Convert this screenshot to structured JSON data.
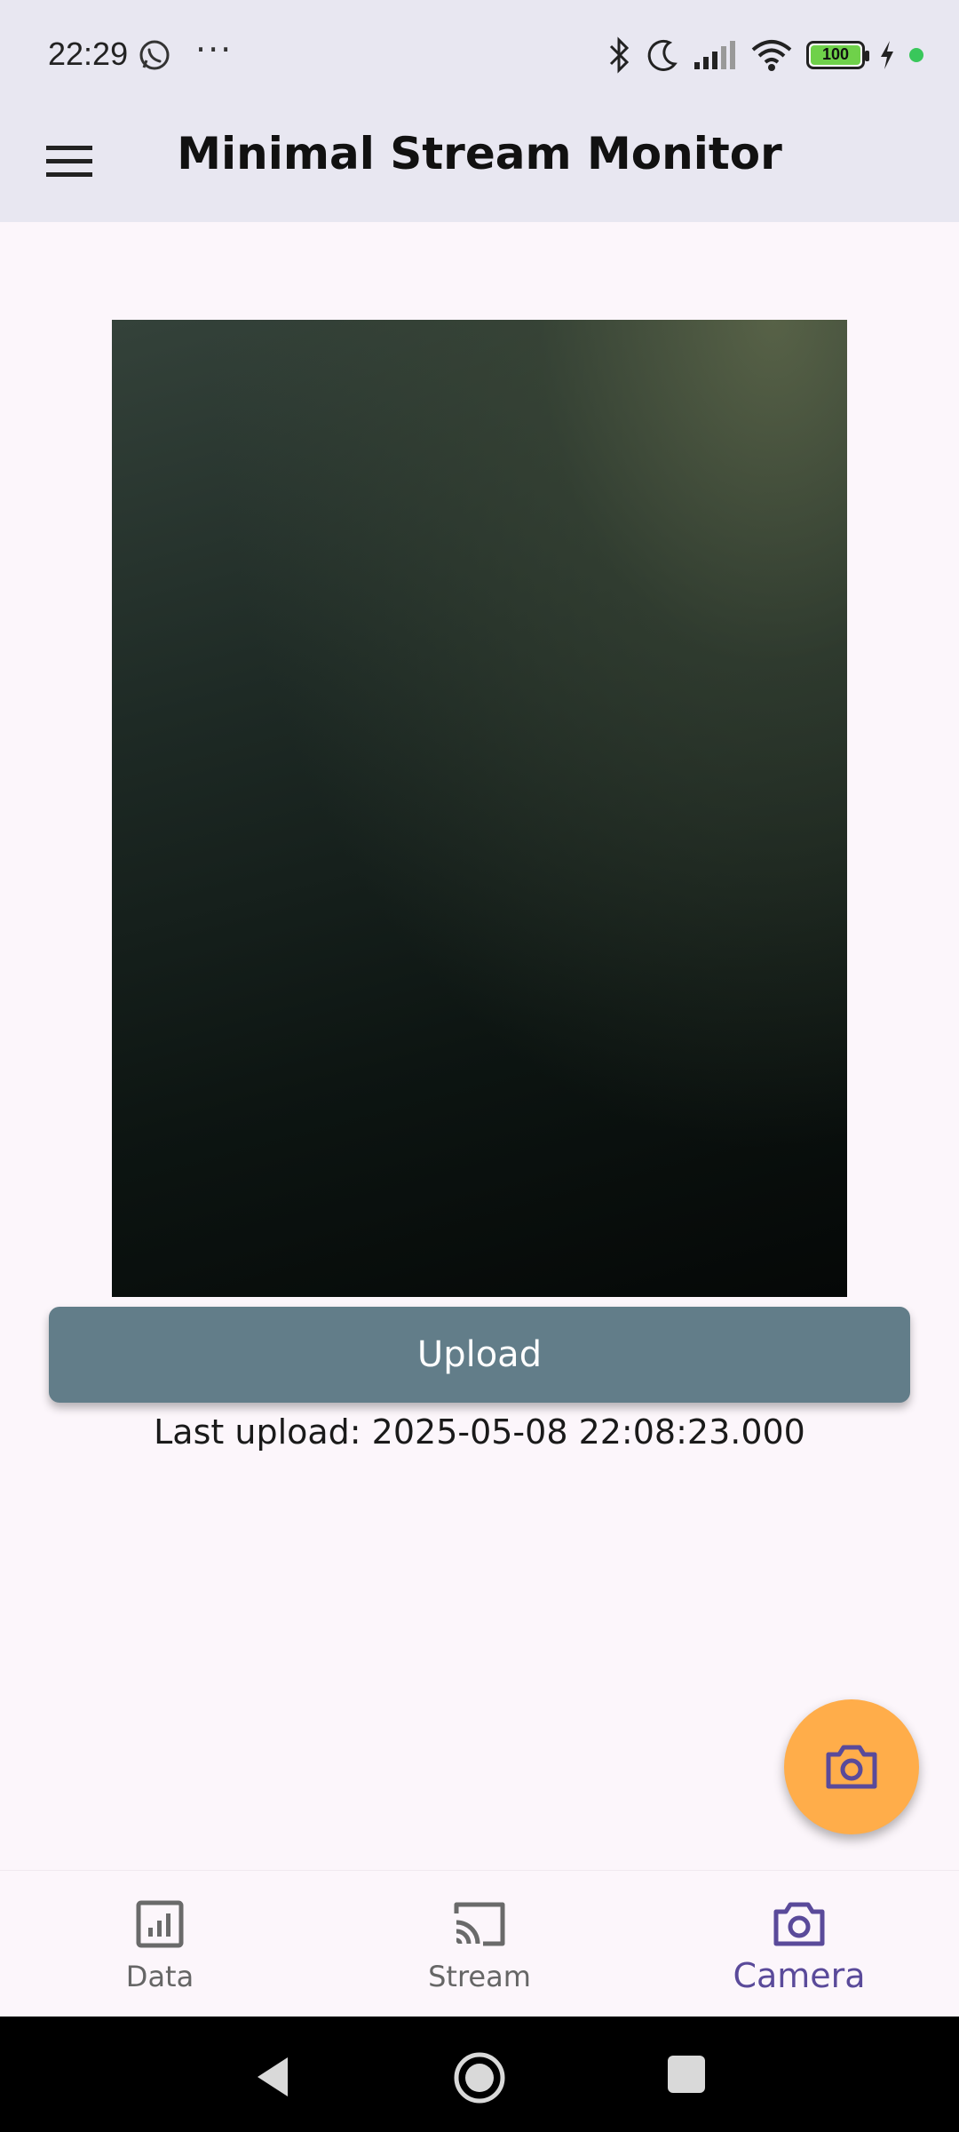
{
  "status": {
    "time": "22:29",
    "dots": "···",
    "battery": "100",
    "icons": [
      "whatsapp-icon",
      "bluetooth-icon",
      "moon-icon",
      "signal-icon",
      "wifi-icon",
      "battery-icon",
      "charging-icon"
    ]
  },
  "appbar": {
    "title": "Minimal Stream Monitor",
    "menu_icon": "menu-icon"
  },
  "main": {
    "upload_label": "Upload",
    "last_upload": "Last upload: 2025-05-08 22:08:23.000"
  },
  "fab": {
    "icon": "camera-icon",
    "color": "#ffad4a"
  },
  "nav": {
    "items": [
      {
        "label": "Data",
        "icon": "chart-icon",
        "active": false
      },
      {
        "label": "Stream",
        "icon": "cast-icon",
        "active": false
      },
      {
        "label": "Camera",
        "icon": "camera-icon",
        "active": true
      }
    ]
  },
  "colors": {
    "upload_button": "#627d89",
    "accent": "#5a4a9a",
    "appbar": "#e8e7f1"
  }
}
